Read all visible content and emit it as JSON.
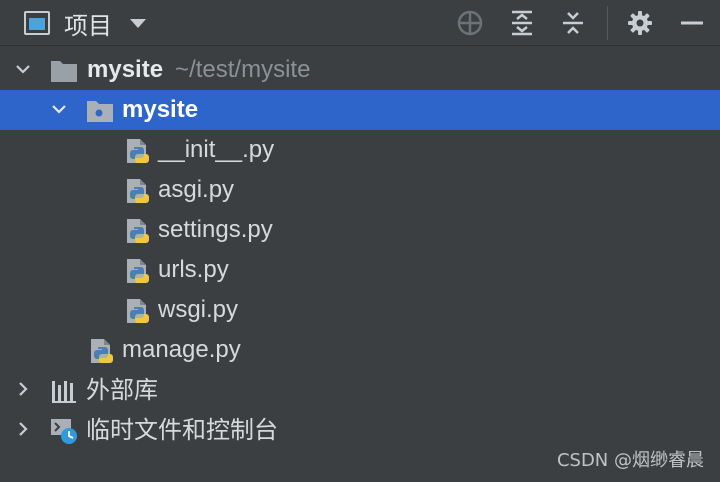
{
  "toolbar": {
    "title": "项目",
    "icons": [
      "view-icon",
      "dropdown-caret-icon",
      "locate-icon",
      "expand-all-icon",
      "collapse-all-icon",
      "gear-icon",
      "minimize-icon"
    ]
  },
  "tree": {
    "root": {
      "name": "mysite",
      "path": "~/test/mysite",
      "icon": "folder-icon",
      "expanded": true
    },
    "package": {
      "name": "mysite",
      "icon": "package-folder-icon",
      "expanded": true,
      "selected": true
    },
    "files": [
      "__init__.py",
      "asgi.py",
      "settings.py",
      "urls.py",
      "wsgi.py"
    ],
    "root_files": [
      "manage.py"
    ],
    "external_libraries": {
      "label": "外部库",
      "icon": "library-icon",
      "expanded": false
    },
    "scratches": {
      "label": "临时文件和控制台",
      "icon": "scratches-icon",
      "expanded": false
    }
  },
  "colors": {
    "background": "#3b3f42",
    "selection": "#2e65ca",
    "text": "#d7d9db",
    "muted": "#8c9195",
    "python_blue": "#4a7fb5",
    "python_yellow": "#f3c63f"
  },
  "watermark": "CSDN @烟缈睿晨"
}
